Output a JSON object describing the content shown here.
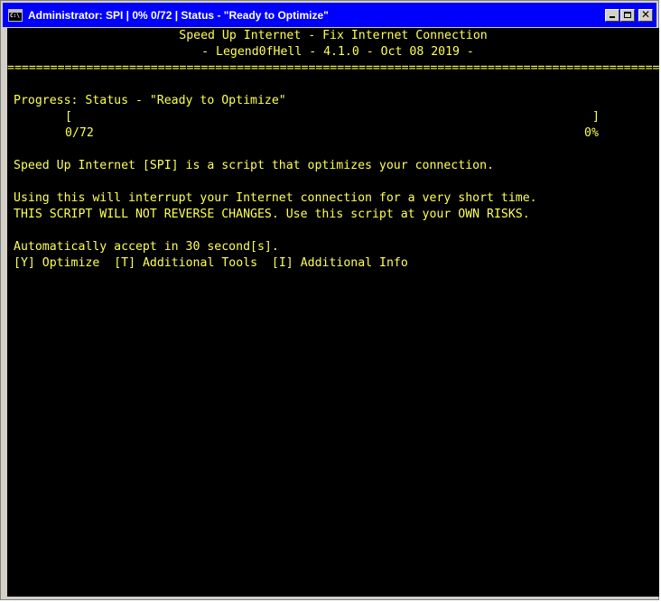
{
  "window": {
    "title": "Administrator:  SPI | 0% 0/72 | Status - \"Ready to Optimize\"",
    "icon": "cmd-icon",
    "title_bar_color": "#0000ff",
    "console_bg": "#000000",
    "text_color": "#ffff55"
  },
  "header": {
    "title": "Speed Up Internet - Fix Internet Connection",
    "subtitle": "- Legend0fHell - 4.1.0 - Oct 08 2019 -",
    "separator": "==============================================================================================="
  },
  "progress": {
    "status_line": "Progress: Status - \"Ready to Optimize\"",
    "bar_open": "[",
    "bar_close": "]",
    "count": "0/72",
    "percent": "0%",
    "fraction": 0
  },
  "body": {
    "description": "Speed Up Internet [SPI] is a script that optimizes your connection.",
    "warning_1": "Using this will interrupt your Internet connection for a very short time.",
    "warning_2": "THIS SCRIPT WILL NOT REVERSE CHANGES. Use this script at your OWN RISKS.",
    "auto_accept": "Automatically accept in 30 second[s].",
    "options": [
      {
        "key": "[Y]",
        "label": "Optimize"
      },
      {
        "key": "[T]",
        "label": "Additional Tools"
      },
      {
        "key": "[I]",
        "label": "Additional Info"
      }
    ]
  }
}
